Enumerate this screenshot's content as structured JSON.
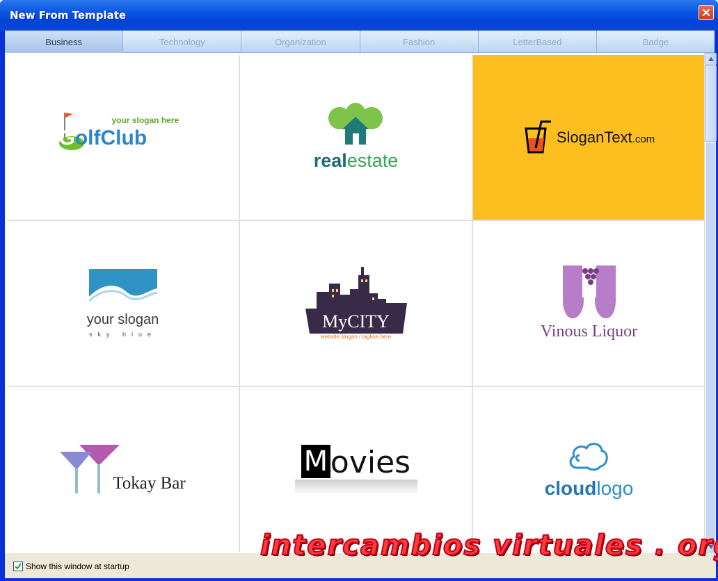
{
  "window": {
    "title": "New From Template"
  },
  "tabs": [
    {
      "label": "Business",
      "active": true
    },
    {
      "label": "Technology",
      "active": false
    },
    {
      "label": "Organization",
      "active": false
    },
    {
      "label": "Fashion",
      "active": false
    },
    {
      "label": "LetterBased",
      "active": false
    },
    {
      "label": "Badge",
      "active": false
    }
  ],
  "templates": [
    {
      "id": "golf",
      "slogan": "your slogan here",
      "name_a": "G",
      "name_b": "olfClub",
      "icon": "golf-flag-icon"
    },
    {
      "id": "realestate",
      "name_a": "real",
      "name_b": "estate",
      "icon": "house-tree-icon"
    },
    {
      "id": "slogantext",
      "name_a": "SloganText",
      "name_b": ".com",
      "icon": "drink-glass-icon",
      "selected": true
    },
    {
      "id": "sky",
      "name": "your slogan",
      "sub": "sky blue",
      "icon": "sky-wave-icon"
    },
    {
      "id": "mycity",
      "name": "MyCITY",
      "sub": "website slogan / tagline here",
      "icon": "city-skyline-icon"
    },
    {
      "id": "vinous",
      "name": "Vinous Liquor",
      "icon": "wine-grapes-icon"
    },
    {
      "id": "tokay",
      "name": "Tokay Bar",
      "icon": "cocktail-glasses-icon"
    },
    {
      "id": "movies",
      "name_a": "M",
      "name_b": "ovies",
      "icon": "film-strip-icon"
    },
    {
      "id": "cloud",
      "name_a": "cloud",
      "name_b": "logo",
      "icon": "cloud-icon"
    }
  ],
  "footer": {
    "show_at_startup_label": "Show this window at startup",
    "show_at_startup_checked": true
  },
  "watermark": "intercambios virtuales . org",
  "colors": {
    "selected_bg": "#fdbe1f",
    "title_bar": "#0a56e0"
  }
}
